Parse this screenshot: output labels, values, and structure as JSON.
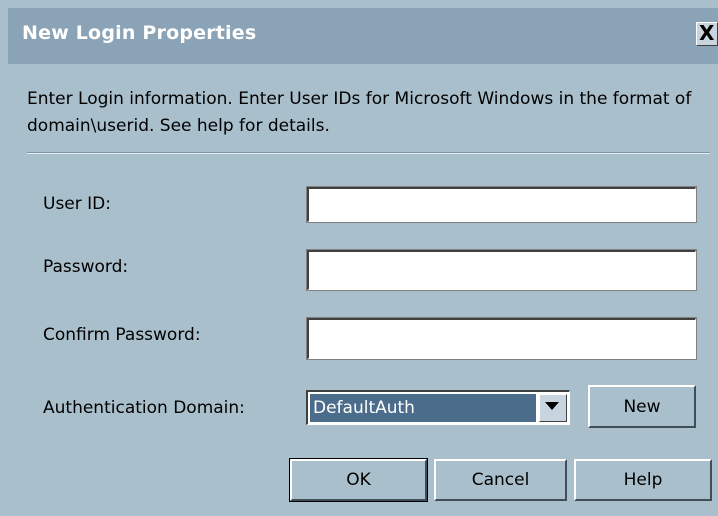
{
  "window": {
    "title": "New Login Properties",
    "close_label": "X"
  },
  "intro": {
    "text": "Enter Login information. Enter User IDs for Microsoft Windows in the format of domain\\userid. See help for details."
  },
  "form": {
    "user_id": {
      "label": "User ID:",
      "value": ""
    },
    "password": {
      "label": "Password:",
      "value": ""
    },
    "confirm_password": {
      "label": "Confirm Password:",
      "value": ""
    },
    "auth_domain": {
      "label": "Authentication Domain:",
      "selected": "DefaultAuth"
    },
    "new_button": "New"
  },
  "buttons": {
    "ok": "OK",
    "cancel": "Cancel",
    "help": "Help"
  },
  "colors": {
    "background": "#a9bfcc",
    "titlebar": "#8aa3b6",
    "selection": "#4b6d8b"
  },
  "icons": {
    "close": "close-icon",
    "dropdown": "chevron-down-icon"
  }
}
